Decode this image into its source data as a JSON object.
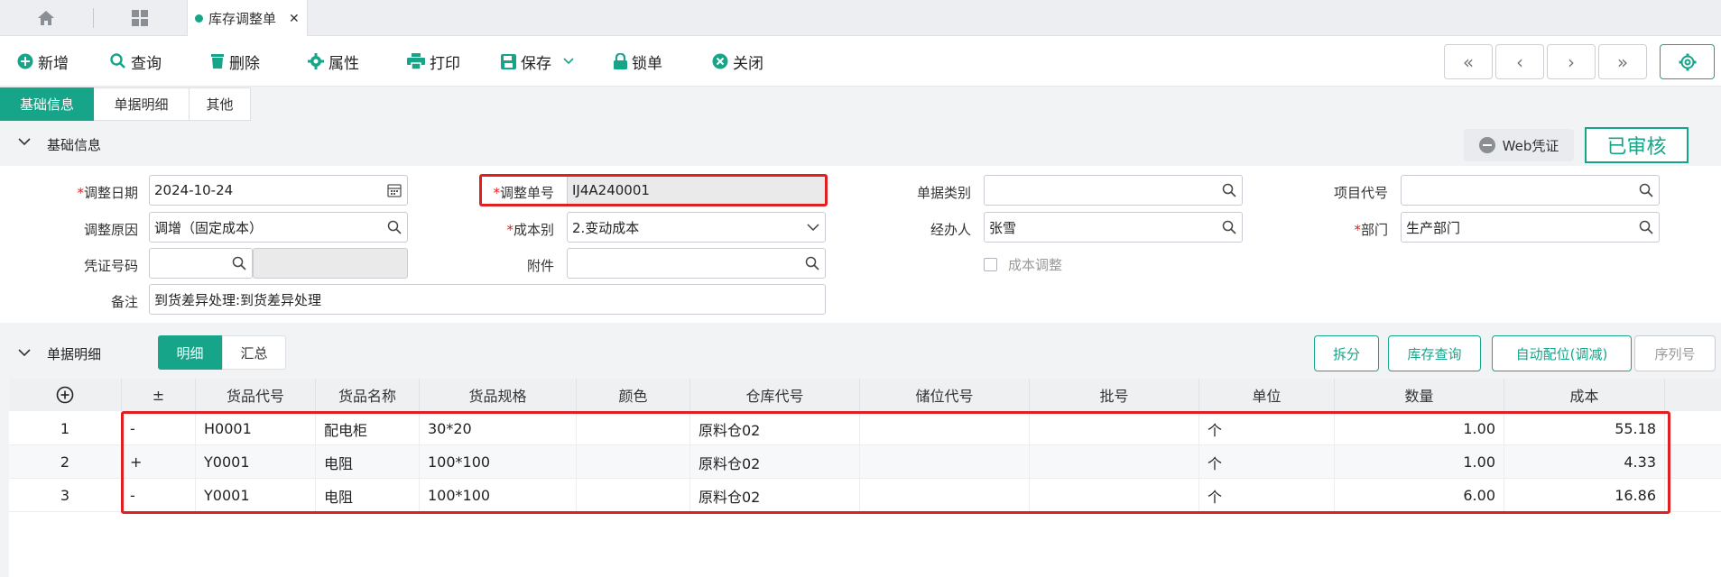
{
  "tabs": {
    "doc_tab_label": "库存调整单",
    "close_glyph": "✕"
  },
  "toolbar": {
    "new": "新增",
    "query": "查询",
    "delete": "删除",
    "properties": "属性",
    "print": "打印",
    "save": "保存",
    "lock": "锁单",
    "close": "关闭",
    "nav_first": "«",
    "nav_prev": "‹",
    "nav_next": "›",
    "nav_last": "»"
  },
  "subtabs": [
    "基础信息",
    "单据明细",
    "其他"
  ],
  "basic_section": {
    "title": "基础信息",
    "web_voucher": "Web凭证",
    "status": "已审核"
  },
  "form": {
    "adjust_date_label": "调整日期",
    "adjust_date": "2024-10-24",
    "adjust_no_label": "调整单号",
    "adjust_no": "IJ4A240001",
    "doc_type_label": "单据类别",
    "doc_type": "",
    "project_code_label": "项目代号",
    "project_code": "",
    "reason_label": "调整原因",
    "reason": "调增（固定成本）",
    "cost_type_label": "成本别",
    "cost_type": "2.变动成本",
    "handler_label": "经办人",
    "handler": "张雪",
    "dept_label": "部门",
    "dept": "生产部门",
    "voucher_label": "凭证号码",
    "voucher": "",
    "attach_label": "附件",
    "attach": "",
    "cost_adjust_label": "成本调整",
    "remark_label": "备注",
    "remark": "到货差异处理:到货差异处理"
  },
  "detail_section": {
    "title": "单据明细",
    "seg_detail": "明细",
    "seg_summary": "汇总",
    "btn_split": "拆分",
    "btn_stock_query": "库存查询",
    "btn_auto_alloc": "自动配位(调减)",
    "btn_serial": "序列号"
  },
  "grid": {
    "columns": [
      "±",
      "货品代号",
      "货品名称",
      "货品规格",
      "颜色",
      "仓库代号",
      "储位代号",
      "批号",
      "单位",
      "数量",
      "成本"
    ],
    "rows": [
      {
        "no": "1",
        "sign": "-",
        "code": "H0001",
        "name": "配电柜",
        "spec": "30*20",
        "color": "",
        "wh": "原料仓02",
        "loc": "",
        "batch": "",
        "unit": "个",
        "qty": "1.00",
        "cost": "55.18"
      },
      {
        "no": "2",
        "sign": "+",
        "code": "Y0001",
        "name": "电阻",
        "spec": "100*100",
        "color": "",
        "wh": "原料仓02",
        "loc": "",
        "batch": "",
        "unit": "个",
        "qty": "1.00",
        "cost": "4.33"
      },
      {
        "no": "3",
        "sign": "-",
        "code": "Y0001",
        "name": "电阻",
        "spec": "100*100",
        "color": "",
        "wh": "原料仓02",
        "loc": "",
        "batch": "",
        "unit": "个",
        "qty": "6.00",
        "cost": "16.86"
      }
    ]
  },
  "colors": {
    "accent": "#17a589",
    "highlight": "#e02020"
  }
}
